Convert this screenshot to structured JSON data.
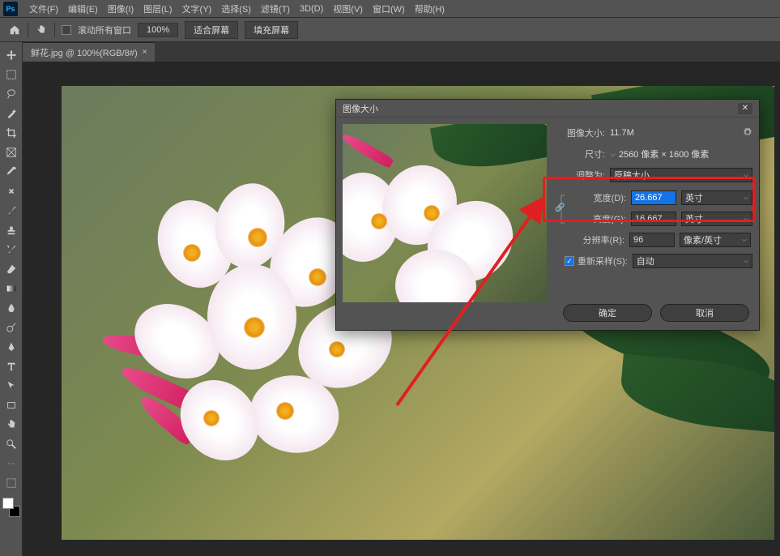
{
  "menubar": {
    "items": [
      "文件(F)",
      "编辑(E)",
      "图像(I)",
      "图层(L)",
      "文字(Y)",
      "选择(S)",
      "滤镜(T)",
      "3D(D)",
      "视图(V)",
      "窗口(W)",
      "帮助(H)"
    ]
  },
  "optionsbar": {
    "scroll_all": "滚动所有窗口",
    "zoom": "100%",
    "fit_screen": "适合屏幕",
    "fill_screen": "填充屏幕"
  },
  "tab": {
    "label": "鲜花.jpg @ 100%(RGB/8#)",
    "close": "×"
  },
  "dialog": {
    "title": "图像大小",
    "close": "✕",
    "image_size_label": "图像大小:",
    "image_size_val": "11.7M",
    "dimensions_label": "尺寸:",
    "dimensions_val": "2560 像素 × 1600 像素",
    "adjust_label": "调整为:",
    "adjust_val": "原稿大小",
    "width_label": "宽度(D):",
    "width_val": "26.667",
    "width_unit": "英寸",
    "height_label": "高度(G):",
    "height_val": "16.667",
    "height_unit": "英寸",
    "resolution_label": "分辨率(R):",
    "resolution_val": "96",
    "resolution_unit": "像素/英寸",
    "resample_label": "重新采样(S):",
    "resample_val": "自动",
    "ok": "确定",
    "cancel": "取消"
  }
}
